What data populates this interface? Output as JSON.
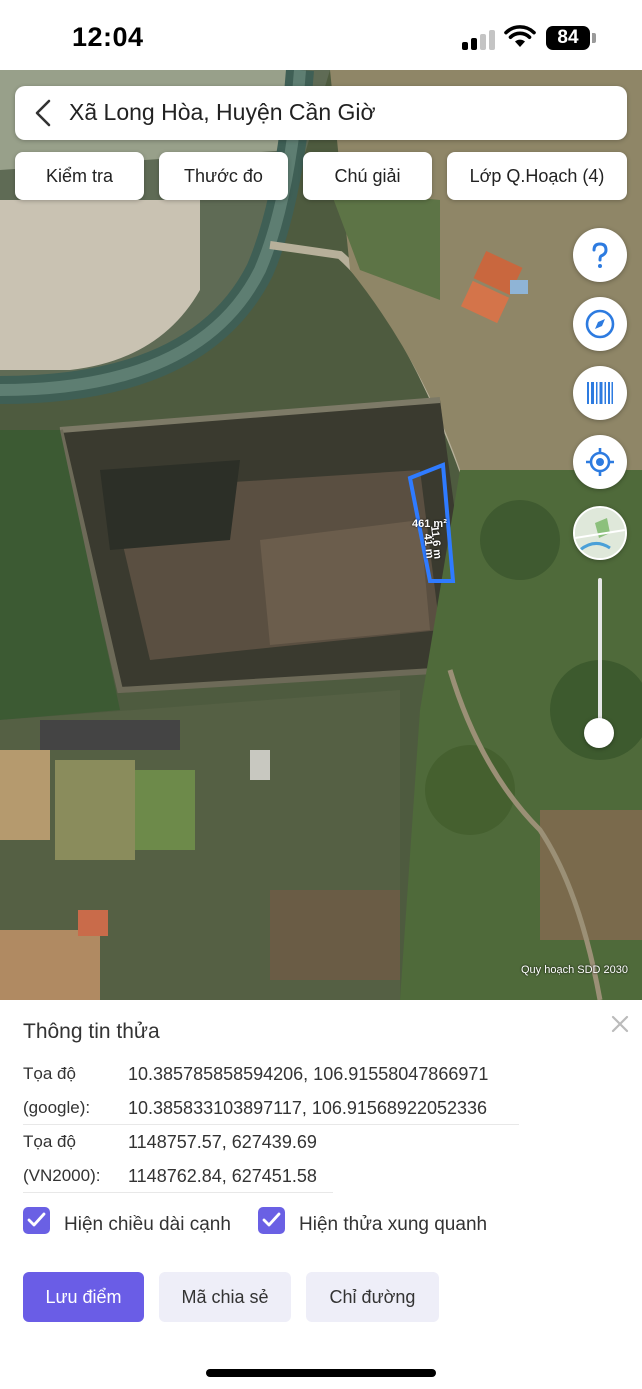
{
  "status_bar": {
    "time": "12:04",
    "battery": "84"
  },
  "map": {
    "location_title": "Xã Long Hòa, Huyện Cần Giờ",
    "toolbar": {
      "check_label": "Kiểm tra",
      "measure_label": "Thước đo",
      "legend_label": "Chú giải",
      "planning_layer_label": "Lớp Q.Hoạch (4)"
    },
    "controls": {
      "help_icon": "question-icon",
      "compass_icon": "compass-icon",
      "barcode_icon": "barcode-icon",
      "locate_icon": "locate-icon",
      "layer_icon": "map-layer-thumbnail"
    },
    "parcel": {
      "area_label": "461 m²",
      "side_label_1": "11.6 m",
      "side_label_2": "41 m",
      "outline_color": "#2f7bff"
    },
    "credit": "Quy hoạch SDD 2030"
  },
  "sheet": {
    "title": "Thông tin thửa",
    "coords_google": {
      "label_1": "Tọa độ",
      "label_2": "(google):",
      "value_1": "10.385785858594206, 106.91558047866971",
      "value_2": "10.385833103897117, 106.91568922052336"
    },
    "coords_vn2000": {
      "label_1": "Tọa độ",
      "label_2": "(VN2000):",
      "value_1": "1148757.57, 627439.69",
      "value_2": "1148762.84, 627451.58"
    },
    "options": {
      "show_edge_lengths": "Hiện chiều dài cạnh",
      "show_neighbors": "Hiện thửa xung quanh"
    },
    "actions": {
      "save": "Lưu điểm",
      "share_code": "Mã chia sẻ",
      "directions": "Chỉ đường"
    },
    "accent_color": "#6a5de6"
  }
}
